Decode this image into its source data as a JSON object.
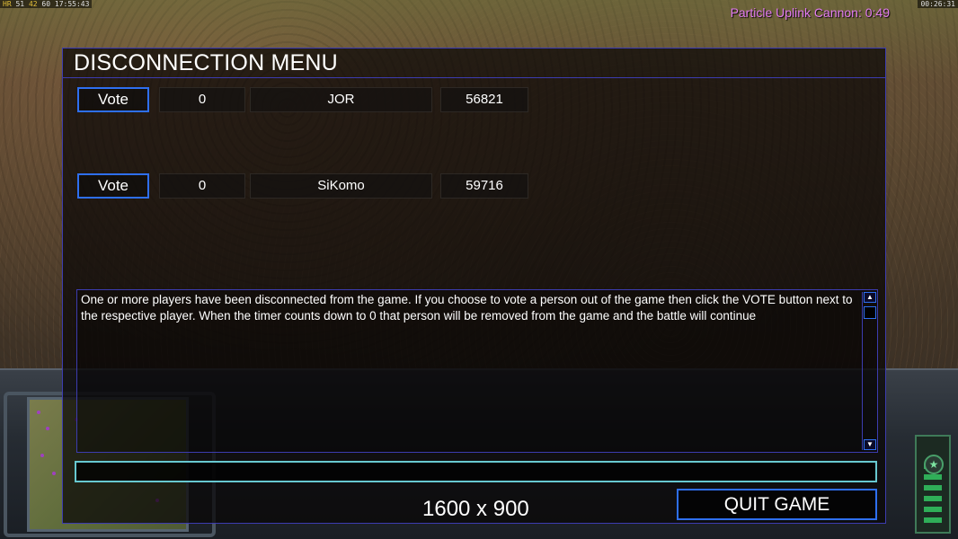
{
  "hud": {
    "fps_prefix": "HR",
    "fps_a": "51",
    "fps_b": "42",
    "fps_c": "60",
    "clock": "17:55:43",
    "game_time": "00:26:31",
    "superweapon_timer": "Particle Uplink Cannon: 0:49"
  },
  "menu": {
    "title": "DISCONNECTION MENU",
    "players": [
      {
        "vote_label": "Vote",
        "votes": "0",
        "name": "JOR",
        "ping": "56821"
      },
      {
        "vote_label": "Vote",
        "votes": "0",
        "name": "SiKomo",
        "ping": "59716"
      }
    ],
    "message": "One or more players have been disconnected from the game. If you choose to vote a person out of the game then click the VOTE button next to the respective player. When the timer counts down to 0 that person will be removed from the game and the battle will continue",
    "chat_input_value": "",
    "resolution_text": "1600 x 900",
    "quit_label": "QUIT GAME"
  },
  "colors": {
    "accent_blue": "#2e6ff0",
    "frame_blue": "#3c3cb0",
    "chat_border": "#67c8d0",
    "timer_pink": "#e27bf0"
  }
}
